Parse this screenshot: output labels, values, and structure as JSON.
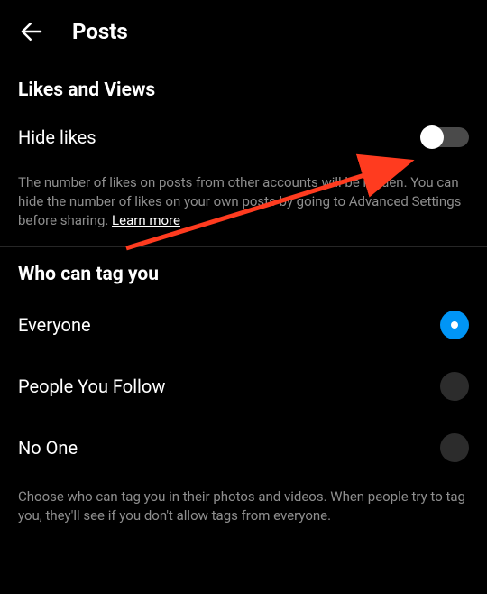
{
  "header": {
    "title": "Posts"
  },
  "section1": {
    "title": "Likes and Views",
    "hide_likes_label": "Hide likes",
    "description_text": "The number of likes on posts from other accounts will be hidden. You can hide the number of likes on your own posts by going to Advanced Settings before sharing. ",
    "learn_more": "Learn more"
  },
  "section2": {
    "title": "Who can tag you",
    "options": [
      {
        "label": "Everyone",
        "selected": true
      },
      {
        "label": "People You Follow",
        "selected": false
      },
      {
        "label": "No One",
        "selected": false
      }
    ],
    "description_text": "Choose who can tag you in their photos and videos. When people try to tag you, they'll see if you don't allow tags from everyone."
  }
}
